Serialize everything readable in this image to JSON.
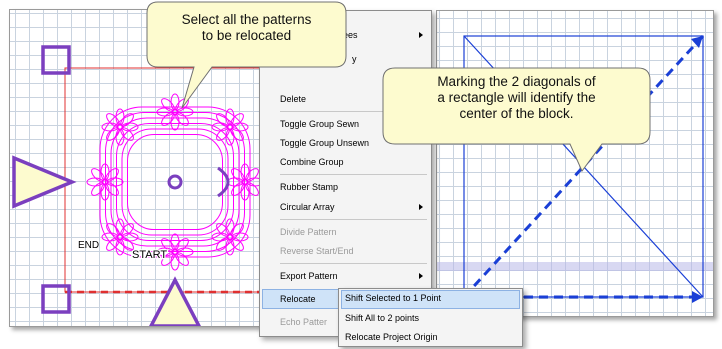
{
  "callouts": {
    "select": "Select all the patterns\nto be relocated",
    "diagonals": "Marking the 2 diagonals of\na rectangle will identify the\ncenter of the block."
  },
  "pattern": {
    "end_label": "END",
    "start_label": "START"
  },
  "context_menu": {
    "partial_top_1": "rees",
    "partial_top_2": "y",
    "items": {
      "delete": "Delete",
      "toggle_sewn": "Toggle Group Sewn",
      "toggle_unsewn": "Toggle Group Unsewn",
      "combine": "Combine Group",
      "rubber_stamp": "Rubber Stamp",
      "circular_array": "Circular Array",
      "divide_pattern": "Divide Pattern",
      "reverse": "Reverse Start/End",
      "export_pattern": "Export Pattern",
      "relocate": "Relocate",
      "echo_pattern": "Echo Patter"
    }
  },
  "submenu": {
    "shift_selected": "Shift Selected to 1 Point",
    "shift_all": "Shift All to 2 points",
    "relocate_origin": "Relocate Project Origin"
  },
  "colors": {
    "pattern": "#ff00ff",
    "handle": "#7b3fbf",
    "selection": "#e03030",
    "diagonal": "#1a3fd6",
    "callout_fill": "#fdfbcf"
  }
}
